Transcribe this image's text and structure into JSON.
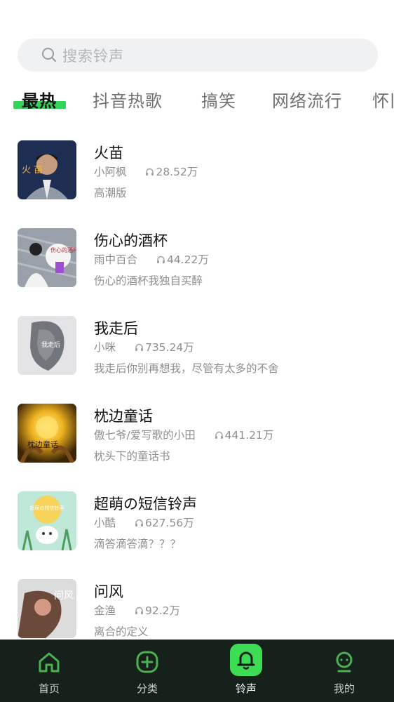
{
  "search": {
    "placeholder": "搜索铃声",
    "icon": "search-icon"
  },
  "tabs": [
    {
      "label": "最热",
      "active": true
    },
    {
      "label": "抖音热歌"
    },
    {
      "label": "搞笑"
    },
    {
      "label": "网络流行"
    },
    {
      "label": "怀旧"
    }
  ],
  "songs": [
    {
      "title": "火苗",
      "artist": "小阿枫",
      "plays": "28.52万",
      "desc": "高潮版"
    },
    {
      "title": "伤心的酒杯",
      "artist": "雨中百合",
      "plays": "44.22万",
      "desc": "伤心的酒杯我独自买醉"
    },
    {
      "title": "我走后",
      "artist": "小咪",
      "plays": "735.24万",
      "desc": "我走后你别再想我，尽管有太多的不舍"
    },
    {
      "title": "枕边童话",
      "artist": "傲七爷/爱写歌的小田",
      "plays": "441.21万",
      "desc": "枕头下的童话书"
    },
    {
      "title": "超萌の短信铃声",
      "artist": "小酷",
      "plays": "627.56万",
      "desc": "滴答滴答滴？？？"
    },
    {
      "title": "问风",
      "artist": "金渔",
      "plays": "92.2万",
      "desc": "离合的定义"
    }
  ],
  "covers": {
    "c1_text": "火 苗",
    "c2_text": "伤心的酒杯",
    "c3_text": "我走后",
    "c4_text": "枕边童话",
    "c5_text": "超萌の短信铃声",
    "c6_text": "问风"
  },
  "nav": [
    {
      "label": "首页",
      "icon": "home-icon"
    },
    {
      "label": "分类",
      "icon": "plus-circle-icon"
    },
    {
      "label": "铃声",
      "icon": "bell-icon",
      "active": true
    },
    {
      "label": "我的",
      "icon": "profile-icon"
    }
  ],
  "colors": {
    "accent": "#3ddc55",
    "nav_bg": "#16211c",
    "search_bg": "#f0f1f3",
    "underline": "#34d45a"
  }
}
